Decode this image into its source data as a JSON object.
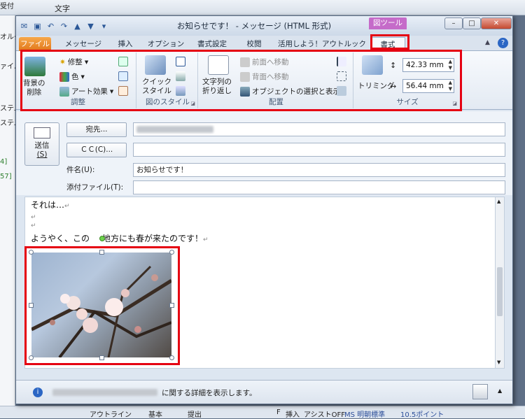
{
  "background_app": {
    "left_labels": [
      "受付",
      "オルダ",
      "ァイル",
      "ステム",
      "ステム",
      "4]",
      "57]"
    ],
    "top_label": "文字",
    "status": {
      "outline": "アウトライン",
      "basic": "基本",
      "submit": "提出",
      "f": "F",
      "insert": "挿入",
      "assist": "アシストOFF",
      "font": "MS 明朝標準",
      "size": "10.5ポイント"
    }
  },
  "window": {
    "title": "お知らせです！ - メッセージ (HTML 形式)",
    "context_tab": "図ツール",
    "minimize": "–",
    "maximize": "□",
    "close": "✕"
  },
  "tabs": [
    {
      "label": "ファイル"
    },
    {
      "label": "メッセージ"
    },
    {
      "label": "挿入"
    },
    {
      "label": "オプション"
    },
    {
      "label": "書式設定"
    },
    {
      "label": "校閲"
    },
    {
      "label": "活用しよう！アウトルック"
    },
    {
      "label": "書式"
    }
  ],
  "ribbon": {
    "adjust": {
      "remove_bg_line1": "背景の",
      "remove_bg_line2": "削除",
      "corrections": "修整",
      "color": "色",
      "artistic": "アート効果",
      "group": "調整"
    },
    "styles": {
      "quick_line1": "クイック",
      "quick_line2": "スタイル",
      "group": "図のスタイル"
    },
    "arrange": {
      "wrap_line1": "文字列の",
      "wrap_line2": "折り返し",
      "bring_forward": "前面へ移動",
      "send_backward": "背面へ移動",
      "selection_pane": "オブジェクトの選択と表示",
      "group": "配置"
    },
    "size": {
      "crop": "トリミング",
      "height": "42.33 mm",
      "width": "56.44 mm",
      "group": "サイズ"
    }
  },
  "form": {
    "send_line1": "送信",
    "send_line2": "(S)",
    "to_button": "宛先...",
    "cc_button": "ＣＣ(C)...",
    "subject_label": "件名(U):",
    "subject_value": "お知らせです！",
    "attach_label": "添付ファイル(T):"
  },
  "body": {
    "line1": "それは…",
    "line3": "ようやく、この",
    "line3b": "地方にも春が来たのです！"
  },
  "infobar": {
    "text": "に関する詳細を表示します。"
  },
  "colors": {
    "highlight": "#e50012",
    "file_tab": "#e0761a",
    "context_tab": "#c56bc9"
  }
}
